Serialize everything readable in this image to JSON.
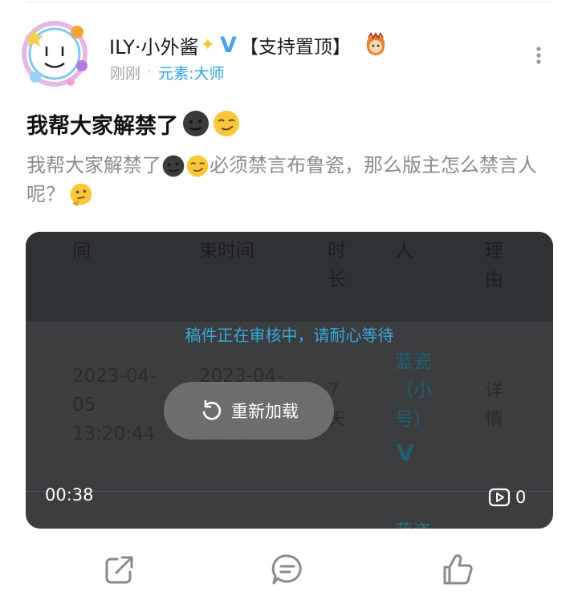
{
  "post": {
    "username": "ILY·小外酱",
    "verified": "V",
    "pin_label": "【支持置顶】",
    "time": "刚刚",
    "separator": "·",
    "element_label": "元素:大师",
    "title": "我帮大家解禁了",
    "body_part1": "我帮大家解禁了",
    "body_part2": "必须禁言布鲁瓷，那么版主怎么禁言人呢？",
    "icons": [
      "avatar",
      "sparkle-icon",
      "verified-icon",
      "badge-icon",
      "more-icon",
      "moon-face-emoji",
      "smirk-face-emoji",
      "thinking-face-emoji"
    ]
  },
  "video": {
    "table_header": [
      "间",
      "束时间",
      "时长",
      "人",
      "理由"
    ],
    "row": {
      "start": "2023-04-05 13:20:44",
      "end": "2023-04-05 13:20:44",
      "duration": "7天",
      "person": "蓝瓷（小号）",
      "person_badge": "V",
      "reason": "详情"
    },
    "peek_text": "蓝瓷",
    "review_text": "稿件正在审核中，请耐心等待",
    "reload_label": "重新加载",
    "duration_text": "00:38",
    "play_count": "0",
    "colors": {
      "review": "#35a9dc",
      "overlay": "#3b3d3f"
    }
  },
  "actions": {
    "icons": [
      "share-icon",
      "comment-icon",
      "like-icon"
    ]
  }
}
